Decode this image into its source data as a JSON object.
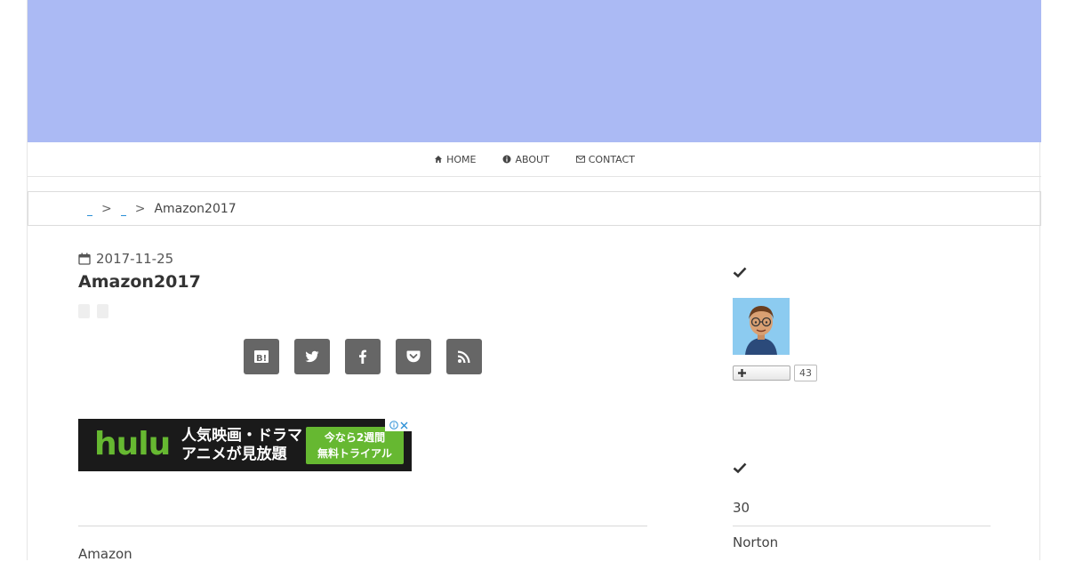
{
  "nav": {
    "home": "HOME",
    "about": "ABOUT",
    "contact": "CONTACT"
  },
  "breadcrumb": {
    "separator": ">",
    "current": "Amazon2017"
  },
  "post": {
    "date": "2017-11-25",
    "title": "Amazon2017",
    "body_first_line": "Amazon"
  },
  "share_icons": [
    "hatena-bookmark-icon",
    "twitter-icon",
    "facebook-icon",
    "pocket-icon",
    "rss-icon"
  ],
  "ad": {
    "logo": "hulu",
    "text_line1": "人気映画・ドラマ・",
    "text_line2": "アニメが見放題",
    "cta_line1": "今なら2週間",
    "cta_line2": "無料トライアル"
  },
  "sidebar": {
    "follow_count": "43",
    "items": [
      "30",
      "Norton"
    ]
  },
  "colors": {
    "header_banner": "#abbaf4",
    "share_button": "#666666",
    "ad_green": "#66b831"
  }
}
